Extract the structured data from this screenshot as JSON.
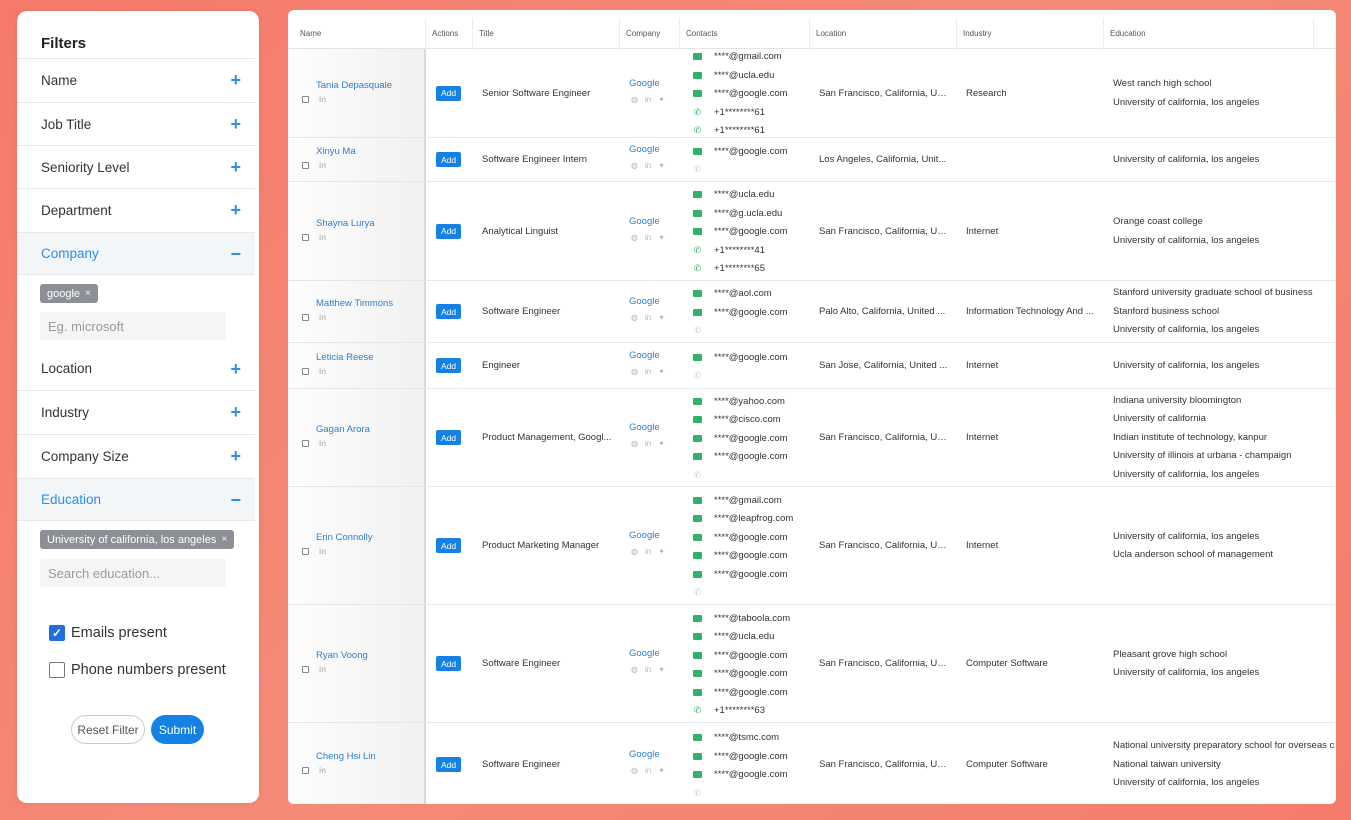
{
  "filters": {
    "title": "Filters",
    "sections": [
      {
        "label": "Name",
        "toggle": "+"
      },
      {
        "label": "Job Title",
        "toggle": "+"
      },
      {
        "label": "Seniority Level",
        "toggle": "+"
      },
      {
        "label": "Department",
        "toggle": "+"
      },
      {
        "label": "Company",
        "toggle": "−"
      },
      {
        "label": "Location",
        "toggle": "+"
      },
      {
        "label": "Industry",
        "toggle": "+"
      },
      {
        "label": "Company Size",
        "toggle": "+"
      },
      {
        "label": "Education",
        "toggle": "−"
      }
    ],
    "company_chip": "google",
    "company_placeholder": "Eg. microsoft",
    "education_chip": "University of california, los angeles",
    "education_placeholder": "Search education...",
    "emails_present": "Emails present",
    "phone_present": "Phone numbers present",
    "chip_remove": "×",
    "reset_label": "Reset Filter",
    "submit_label": "Submit"
  },
  "table": {
    "headers": [
      "Name",
      "Actions",
      "Title",
      "Company",
      "Contacts",
      "Location",
      "Industry",
      "Education"
    ],
    "add_label": "Add",
    "linkedin_label": "in",
    "rows": [
      {
        "name": "Tania Depasquale",
        "title": "Senior Software Engineer",
        "company": "Google",
        "contacts": [
          {
            "type": "email",
            "value": "****@gmail.com"
          },
          {
            "type": "email",
            "value": "****@ucla.edu"
          },
          {
            "type": "email",
            "value": "****@google.com"
          },
          {
            "type": "phone",
            "value": "+1********61"
          },
          {
            "type": "phone",
            "value": "+1********61"
          }
        ],
        "location": "San Francisco, California, Un...",
        "industry": "Research",
        "education": [
          "West ranch high school",
          "University of california, los angeles"
        ]
      },
      {
        "name": "Xinyu Ma",
        "title": "Software Engineer Intern",
        "company": "Google",
        "contacts": [
          {
            "type": "email",
            "value": "****@google.com"
          },
          {
            "type": "phone-empty",
            "value": ""
          }
        ],
        "location": "Los Angeles, California, Unit...",
        "industry": "",
        "education": [
          "University of california, los angeles"
        ]
      },
      {
        "name": "Shayna Lurya",
        "title": "Analytical Linguist",
        "company": "Google",
        "contacts": [
          {
            "type": "email",
            "value": "****@ucla.edu"
          },
          {
            "type": "email",
            "value": "****@g.ucla.edu"
          },
          {
            "type": "email",
            "value": "****@google.com"
          },
          {
            "type": "phone",
            "value": "+1********41"
          },
          {
            "type": "phone",
            "value": "+1********65"
          }
        ],
        "location": "San Francisco, California, Un...",
        "industry": "Internet",
        "education": [
          "Orange coast college",
          "University of california, los angeles"
        ]
      },
      {
        "name": "Matthew Timmons",
        "title": "Software Engineer",
        "company": "Google",
        "contacts": [
          {
            "type": "email",
            "value": "****@aol.com"
          },
          {
            "type": "email",
            "value": "****@google.com"
          },
          {
            "type": "phone-empty",
            "value": ""
          }
        ],
        "location": "Palo Alto, California, United ...",
        "industry": "Information Technology And ...",
        "education": [
          "Stanford university graduate school of business",
          "Stanford business school",
          "University of california, los angeles"
        ]
      },
      {
        "name": "Leticia Reese",
        "title": "Engineer",
        "company": "Google",
        "contacts": [
          {
            "type": "email",
            "value": "****@google.com"
          },
          {
            "type": "phone-empty",
            "value": ""
          }
        ],
        "location": "San Jose, California, United ...",
        "industry": "Internet",
        "education": [
          "University of california, los angeles"
        ]
      },
      {
        "name": "Gagan Arora",
        "title": "Product Management, Googl...",
        "company": "Google",
        "contacts": [
          {
            "type": "email",
            "value": "****@yahoo.com"
          },
          {
            "type": "email",
            "value": "****@cisco.com"
          },
          {
            "type": "email",
            "value": "****@google.com"
          },
          {
            "type": "email",
            "value": "****@google.com"
          },
          {
            "type": "phone-empty",
            "value": ""
          }
        ],
        "location": "San Francisco, California, Un...",
        "industry": "Internet",
        "education": [
          "Indiana university bloomington",
          "University of california",
          "Indian institute of technology, kanpur",
          "University of illinois at urbana - champaign",
          "University of california, los angeles"
        ]
      },
      {
        "name": "Erin Connolly",
        "title": "Product Marketing Manager",
        "company": "Google",
        "contacts": [
          {
            "type": "email",
            "value": "****@gmail.com"
          },
          {
            "type": "email",
            "value": "****@leapfrog.com"
          },
          {
            "type": "email",
            "value": "****@google.com"
          },
          {
            "type": "email",
            "value": "****@google.com"
          },
          {
            "type": "email",
            "value": "****@google.com"
          },
          {
            "type": "phone-empty",
            "value": ""
          }
        ],
        "location": "San Francisco, California, Un...",
        "industry": "Internet",
        "education": [
          "University of california, los angeles",
          "Ucla anderson school of management"
        ]
      },
      {
        "name": "Ryan Voong",
        "title": "Software Engineer",
        "company": "Google",
        "contacts": [
          {
            "type": "email",
            "value": "****@taboola.com"
          },
          {
            "type": "email",
            "value": "****@ucla.edu"
          },
          {
            "type": "email",
            "value": "****@google.com"
          },
          {
            "type": "email",
            "value": "****@google.com"
          },
          {
            "type": "email",
            "value": "****@google.com"
          },
          {
            "type": "phone",
            "value": "+1********63"
          }
        ],
        "location": "San Francisco, California, Un...",
        "industry": "Computer Software",
        "education": [
          "Pleasant grove high school",
          "University of california, los angeles"
        ]
      },
      {
        "name": "Cheng Hsi Lin",
        "title": "Software Engineer",
        "company": "Google",
        "contacts": [
          {
            "type": "email",
            "value": "****@tsmc.com"
          },
          {
            "type": "email",
            "value": "****@google.com"
          },
          {
            "type": "email",
            "value": "****@google.com"
          },
          {
            "type": "phone-empty",
            "value": ""
          }
        ],
        "location": "San Francisco, California, Un...",
        "industry": "Computer Software",
        "education": [
          "National university preparatory school for overseas chinese",
          "National taiwan university",
          "University of california, los angeles"
        ]
      }
    ]
  }
}
